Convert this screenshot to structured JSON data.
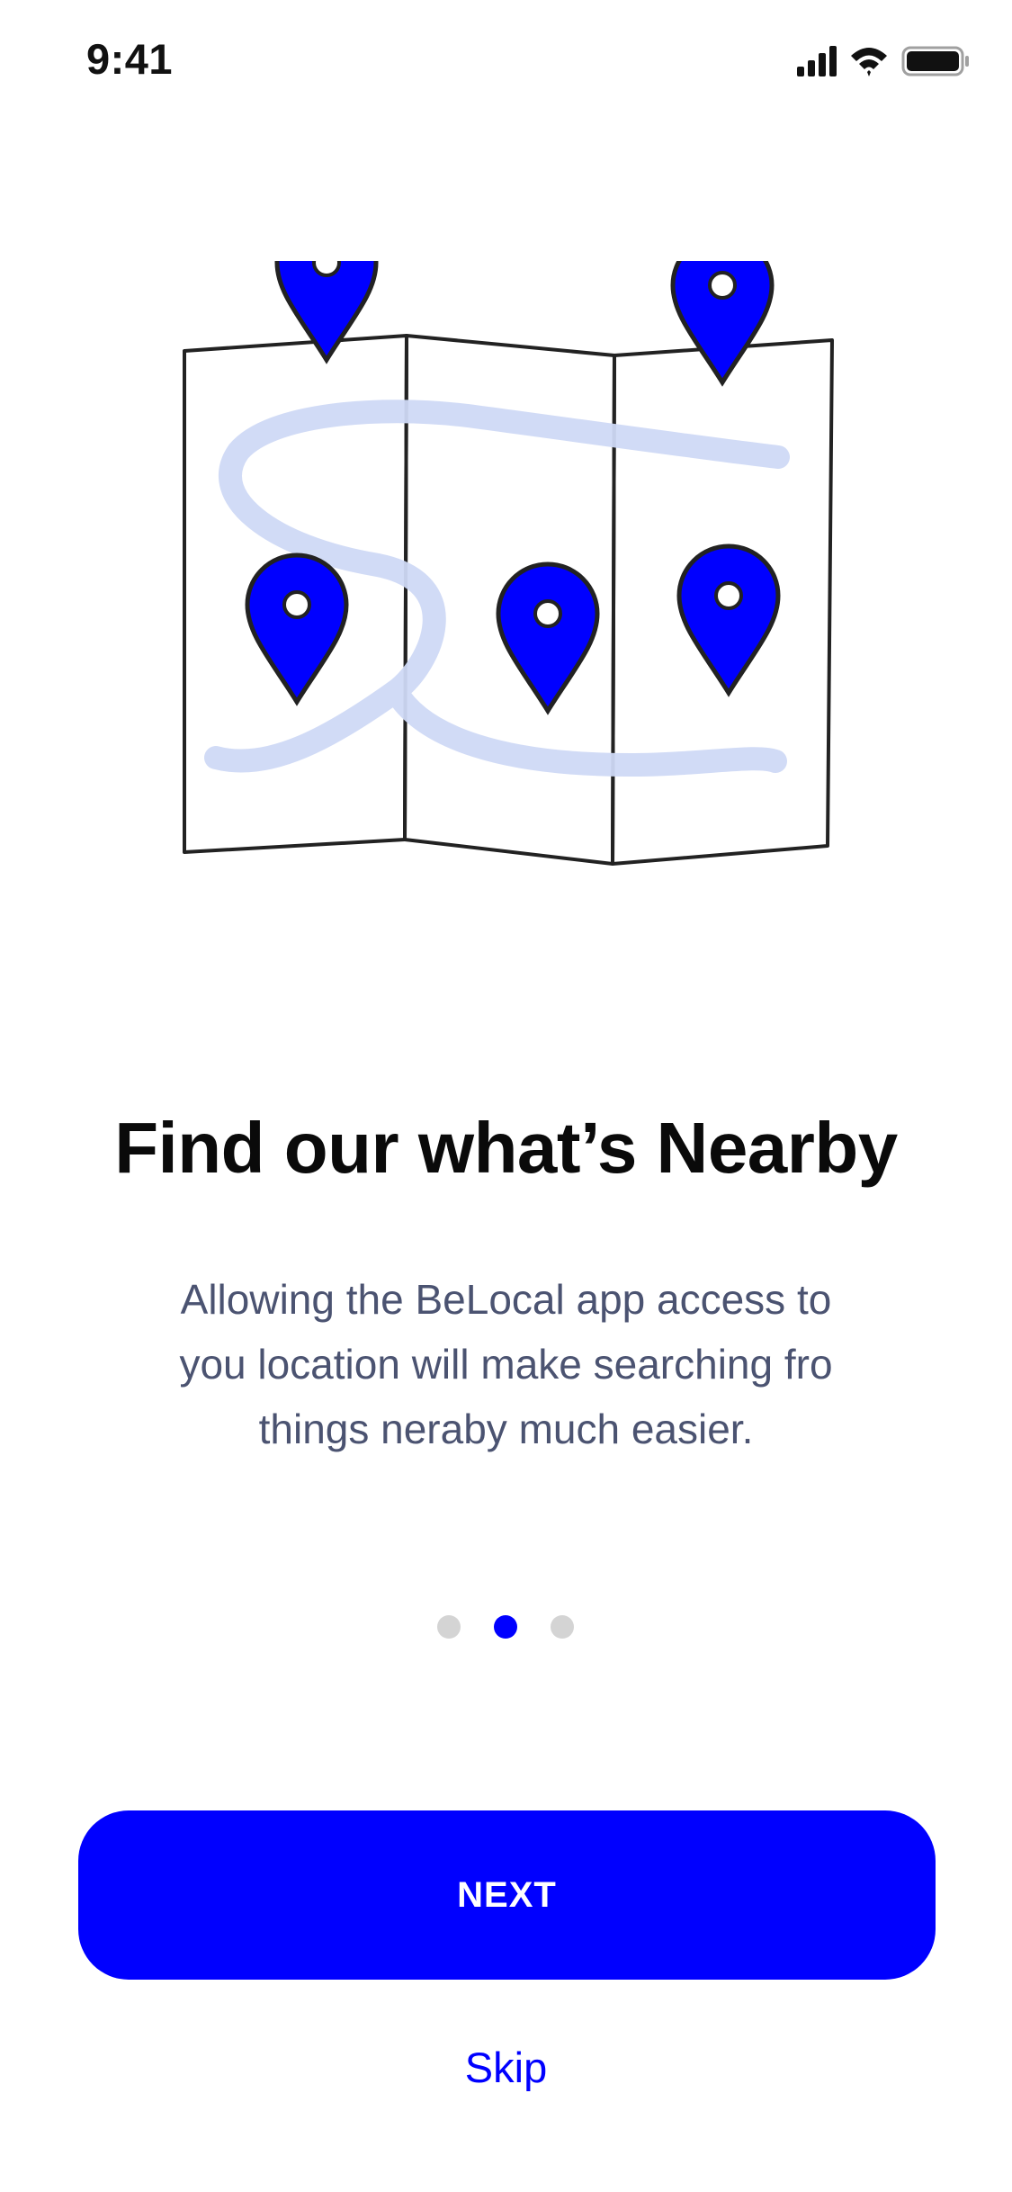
{
  "status_bar": {
    "time": "9:41",
    "icons": [
      "cellular-signal-icon",
      "wifi-icon",
      "battery-icon"
    ]
  },
  "onboarding": {
    "title": "Find our what’s Nearby",
    "description": "Allowing the BeLocal app access to you location will make searching fro things neraby much easier.",
    "pager": {
      "total": 3,
      "active_index": 1
    },
    "next_label": "NEXT",
    "skip_label": "Skip"
  },
  "colors": {
    "accent": "#0000ff",
    "route": "#cfd9f6",
    "dot_inactive": "#d4d4d4",
    "text_secondary": "#4b5371"
  }
}
